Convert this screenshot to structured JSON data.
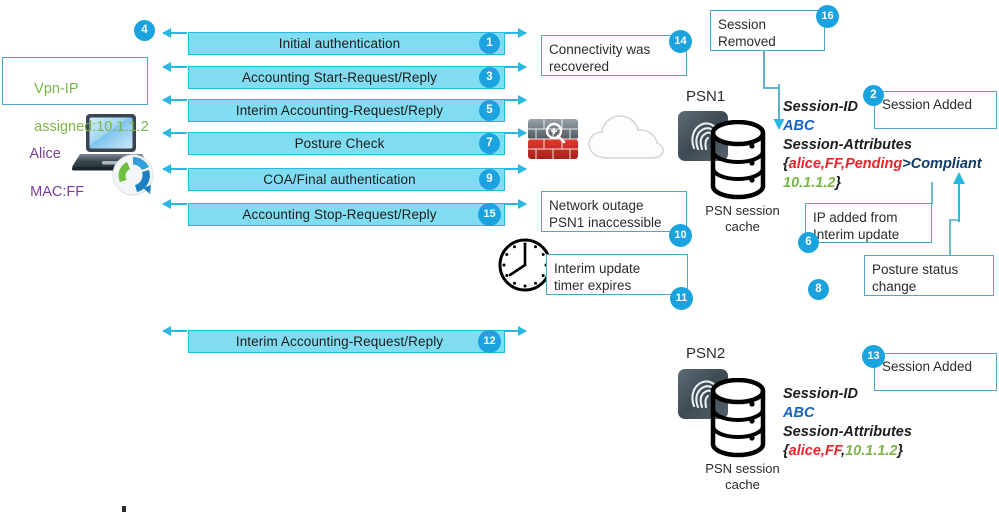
{
  "diagram": {
    "title": "ISE PSN session cache flow",
    "colors": {
      "bar_fill": "#7fdcf1",
      "bar_border": "#29b8e0",
      "badge": "#1aa3de",
      "callout_border": "#4fa8c8",
      "green_text": "#7ab648",
      "purple_text": "#7b3f98",
      "red_text": "#e8262a",
      "navy_text": "#0f3b66",
      "abc_blue": "#1565c0"
    }
  },
  "endpoint": {
    "name_line1": "Alice",
    "name_line2": "MAC:FF",
    "laptop_icon": "laptop-icon",
    "anyconnect_icon": "anyconnect-icon"
  },
  "vpn_callout": {
    "line1": "Vpn-IP",
    "line2": "assigned:10.1.1.2",
    "badge": "4"
  },
  "messages": [
    {
      "label": "Initial authentication",
      "badge": "1"
    },
    {
      "label": "Accounting Start-Request/Reply",
      "badge": "3"
    },
    {
      "label": "Interim Accounting-Request/Reply",
      "badge": "5"
    },
    {
      "label": "Posture Check",
      "badge": "7"
    },
    {
      "label": "COA/Final authentication",
      "badge": "9"
    },
    {
      "label": "Accounting Stop-Request/Reply",
      "badge": "15"
    },
    {
      "label": "Interim Accounting-Request/Reply",
      "badge": "12"
    }
  ],
  "network": {
    "firewall_icon": "firewall-icon",
    "cloud_icon": "cloud-icon",
    "clock_icon": "clock-icon"
  },
  "callouts": [
    {
      "id": "connectivity-recovered",
      "line1": "Connectivity was",
      "line2": "recovered",
      "badge": "14"
    },
    {
      "id": "session-removed",
      "line1": "Session",
      "line2": "Removed",
      "badge": "16"
    },
    {
      "id": "session-added-psn1",
      "line1": "Session Added",
      "line2": "",
      "badge": "2"
    },
    {
      "id": "network-outage",
      "line1": "Network outage",
      "line2": "PSN1 inaccessible",
      "badge": "10"
    },
    {
      "id": "interim-timer",
      "line1": "Interim update",
      "line2": "timer expires",
      "badge": "11"
    },
    {
      "id": "ip-added",
      "line1": "IP added from",
      "line2": "Interim update",
      "badge": "6"
    },
    {
      "id": "posture-status",
      "line1": "Posture status",
      "line2": "change",
      "badge": "8"
    },
    {
      "id": "session-added-psn2",
      "line1": "Session Added",
      "line2": "",
      "badge": "13"
    }
  ],
  "psn1": {
    "name": "PSN1",
    "server_icon": "ise-server-icon",
    "db_icon": "database-cylinder-icon",
    "caption_line1": "PSN session",
    "caption_line2": "cache",
    "session_id_label": "Session-ID",
    "session_id_value": "ABC",
    "session_attributes_label": "Session-Attributes",
    "attr_open_brace": "{",
    "attr_red": "alice,FF,Pending",
    "attr_navy": ">Compliant",
    "attr_green": "10.1.1.2",
    "attr_close_brace": "}"
  },
  "psn2": {
    "name": "PSN2",
    "server_icon": "ise-server-icon",
    "db_icon": "database-cylinder-icon",
    "caption_line1": "PSN session",
    "caption_line2": "cache",
    "session_id_label": "Session-ID",
    "session_id_value": "ABC",
    "session_attributes_label": "Session-Attributes",
    "attr_open_brace": "{",
    "attr_red_name": "alice,",
    "attr_red_mac": "FF",
    "attr_comma": ",",
    "attr_green": "10.1.1.2",
    "attr_close_brace": "}"
  }
}
